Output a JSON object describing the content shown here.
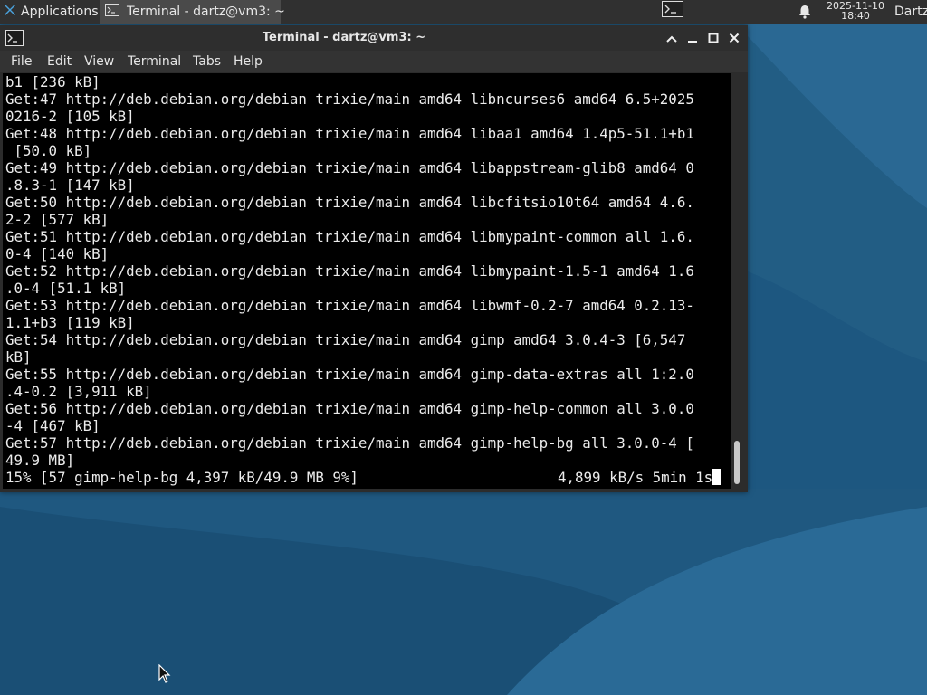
{
  "panel": {
    "applications_label": "Applications",
    "applications_separator": "☰",
    "task_title": "Terminal - dartz@vm3: ~",
    "clock_date": "2025-11-10",
    "clock_time": "18:40",
    "user_label": "Dartz"
  },
  "window": {
    "title": "Terminal - dartz@vm3: ~",
    "menu": [
      "File",
      "Edit",
      "View",
      "Terminal",
      "Tabs",
      "Help"
    ]
  },
  "terminal": {
    "lines": [
      "b1 [236 kB]",
      "Get:47 http://deb.debian.org/debian trixie/main amd64 libncurses6 amd64 6.5+2025",
      "0216-2 [105 kB]",
      "Get:48 http://deb.debian.org/debian trixie/main amd64 libaa1 amd64 1.4p5-51.1+b1",
      " [50.0 kB]",
      "Get:49 http://deb.debian.org/debian trixie/main amd64 libappstream-glib8 amd64 0",
      ".8.3-1 [147 kB]",
      "Get:50 http://deb.debian.org/debian trixie/main amd64 libcfitsio10t64 amd64 4.6.",
      "2-2 [577 kB]",
      "Get:51 http://deb.debian.org/debian trixie/main amd64 libmypaint-common all 1.6.",
      "0-4 [140 kB]",
      "Get:52 http://deb.debian.org/debian trixie/main amd64 libmypaint-1.5-1 amd64 1.6",
      ".0-4 [51.1 kB]",
      "Get:53 http://deb.debian.org/debian trixie/main amd64 libwmf-0.2-7 amd64 0.2.13-",
      "1.1+b3 [119 kB]",
      "Get:54 http://deb.debian.org/debian trixie/main amd64 gimp amd64 3.0.4-3 [6,547",
      "kB]",
      "Get:55 http://deb.debian.org/debian trixie/main amd64 gimp-data-extras all 1:2.0",
      ".4-0.2 [3,911 kB]",
      "Get:56 http://deb.debian.org/debian trixie/main amd64 gimp-help-common all 3.0.0",
      "-4 [467 kB]",
      "Get:57 http://deb.debian.org/debian trixie/main amd64 gimp-help-bg all 3.0.0-4 [",
      "49.9 MB]"
    ],
    "progress_left": "15% [57 gimp-help-bg 4,397 kB/49.9 MB 9%]",
    "progress_right": "4,899 kB/s 5min 1s"
  },
  "icons": {
    "apps": "xfce-logo-icon",
    "terminal": "terminal-icon",
    "bell": "bell-icon",
    "pointer": "mouse-pointer-icon"
  },
  "colors": {
    "panel_bg": "#303030",
    "terminal_bg": "#000000",
    "terminal_fg": "#ececec",
    "desktop_blue": "#1f5a82"
  }
}
